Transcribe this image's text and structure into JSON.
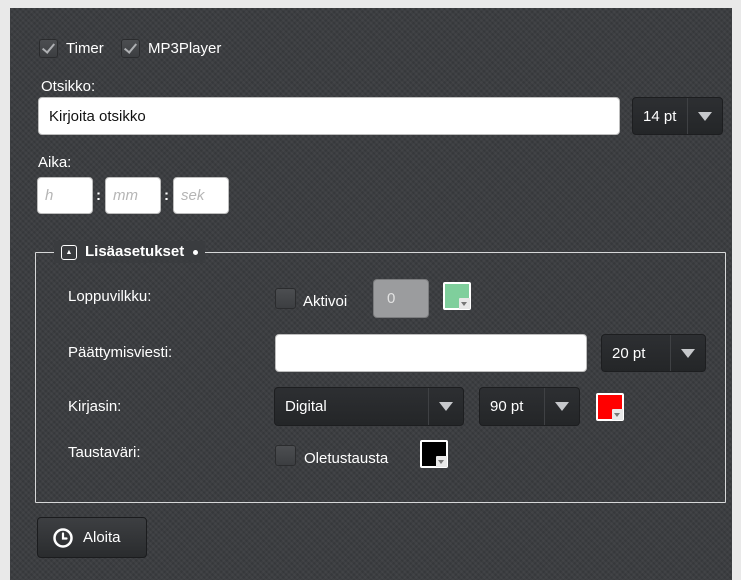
{
  "options": {
    "timer_label": "Timer",
    "mp3_label": "MP3Player",
    "timer_checked": true,
    "mp3_checked": true
  },
  "title_section": {
    "label": "Otsikko:",
    "input_value": "Kirjoita otsikko",
    "font_size": "14 pt"
  },
  "time_section": {
    "label": "Aika:",
    "hours_placeholder": "h",
    "minutes_placeholder": "mm",
    "seconds_placeholder": "sek",
    "separator": ":"
  },
  "advanced": {
    "legend_label": "Lisäasetukset",
    "toggle_icon": "▲",
    "end_blink": {
      "label": "Loppuvilkku:",
      "checkbox_label": "Aktivoi",
      "count_value": "0",
      "color": "#7fcf9c"
    },
    "end_message": {
      "label": "Päättymisviesti:",
      "input_value": "",
      "font_size": "20 pt"
    },
    "font": {
      "label": "Kirjasin:",
      "family": "Digital",
      "size": "90 pt",
      "color": "#ff0000"
    },
    "background": {
      "label": "Taustaväri:",
      "checkbox_label": "Oletustausta",
      "color": "#000000"
    }
  },
  "start_button": {
    "label": "Aloita",
    "icon": "clock-icon"
  }
}
